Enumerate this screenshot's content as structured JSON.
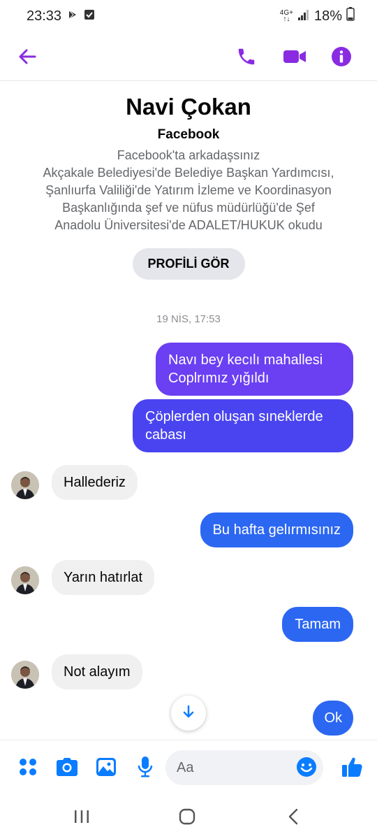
{
  "status_bar": {
    "time": "23:33",
    "network_top": "4G+",
    "network_bottom": "↑↓",
    "battery_percent": "18%"
  },
  "header": {
    "icons": [
      "back-arrow-icon",
      "phone-icon",
      "video-camera-icon",
      "info-icon"
    ]
  },
  "profile": {
    "name": "Navi Çokan",
    "platform": "Facebook",
    "friends_note": "Facebook'ta arkadaşsınız",
    "details": [
      "Akçakale Belediyesi'de Belediye Başkan Yardımcısı,",
      "Şanlıurfa Valiliği'de Yatırım İzleme ve Koordinasyon",
      "Başkanlığında şef ve nüfus müdürlüğü'de Şef",
      "Anadolu Üniversitesi'de ADALET/HUKUK okudu"
    ],
    "view_profile_label": "PROFİLİ GÖR"
  },
  "chat": {
    "timestamp": "19 NİS, 17:53",
    "messages": [
      {
        "direction": "outgoing",
        "lines": [
          "Navı bey kecılı  mahallesi",
          "Coplrımız  yığıldı"
        ]
      },
      {
        "direction": "outgoing",
        "lines": [
          "Çöplerden oluşan sıneklerde",
          "cabası"
        ]
      },
      {
        "direction": "incoming",
        "lines": [
          "Hallederiz"
        ]
      },
      {
        "direction": "outgoing",
        "lines": [
          "Bu hafta gelırmısınız"
        ]
      },
      {
        "direction": "incoming",
        "lines": [
          "Yarın hatırlat"
        ]
      },
      {
        "direction": "outgoing",
        "lines": [
          "Tamam"
        ]
      },
      {
        "direction": "incoming",
        "lines": [
          "Not alayım"
        ]
      },
      {
        "direction": "outgoing",
        "lines": [
          "Ok"
        ]
      }
    ]
  },
  "composer": {
    "placeholder": "Aa",
    "icons": [
      "apps-dots-icon",
      "camera-icon",
      "gallery-icon",
      "microphone-icon",
      "emoji-icon",
      "like-thumb-icon"
    ]
  },
  "colors": {
    "accent": "#8a2be2",
    "bubble_purple": "#6b3ff2",
    "bubble_indigo": "#4a44f0",
    "bubble_blue": "#2c67f2",
    "composer_blue": "#0a7cff"
  }
}
